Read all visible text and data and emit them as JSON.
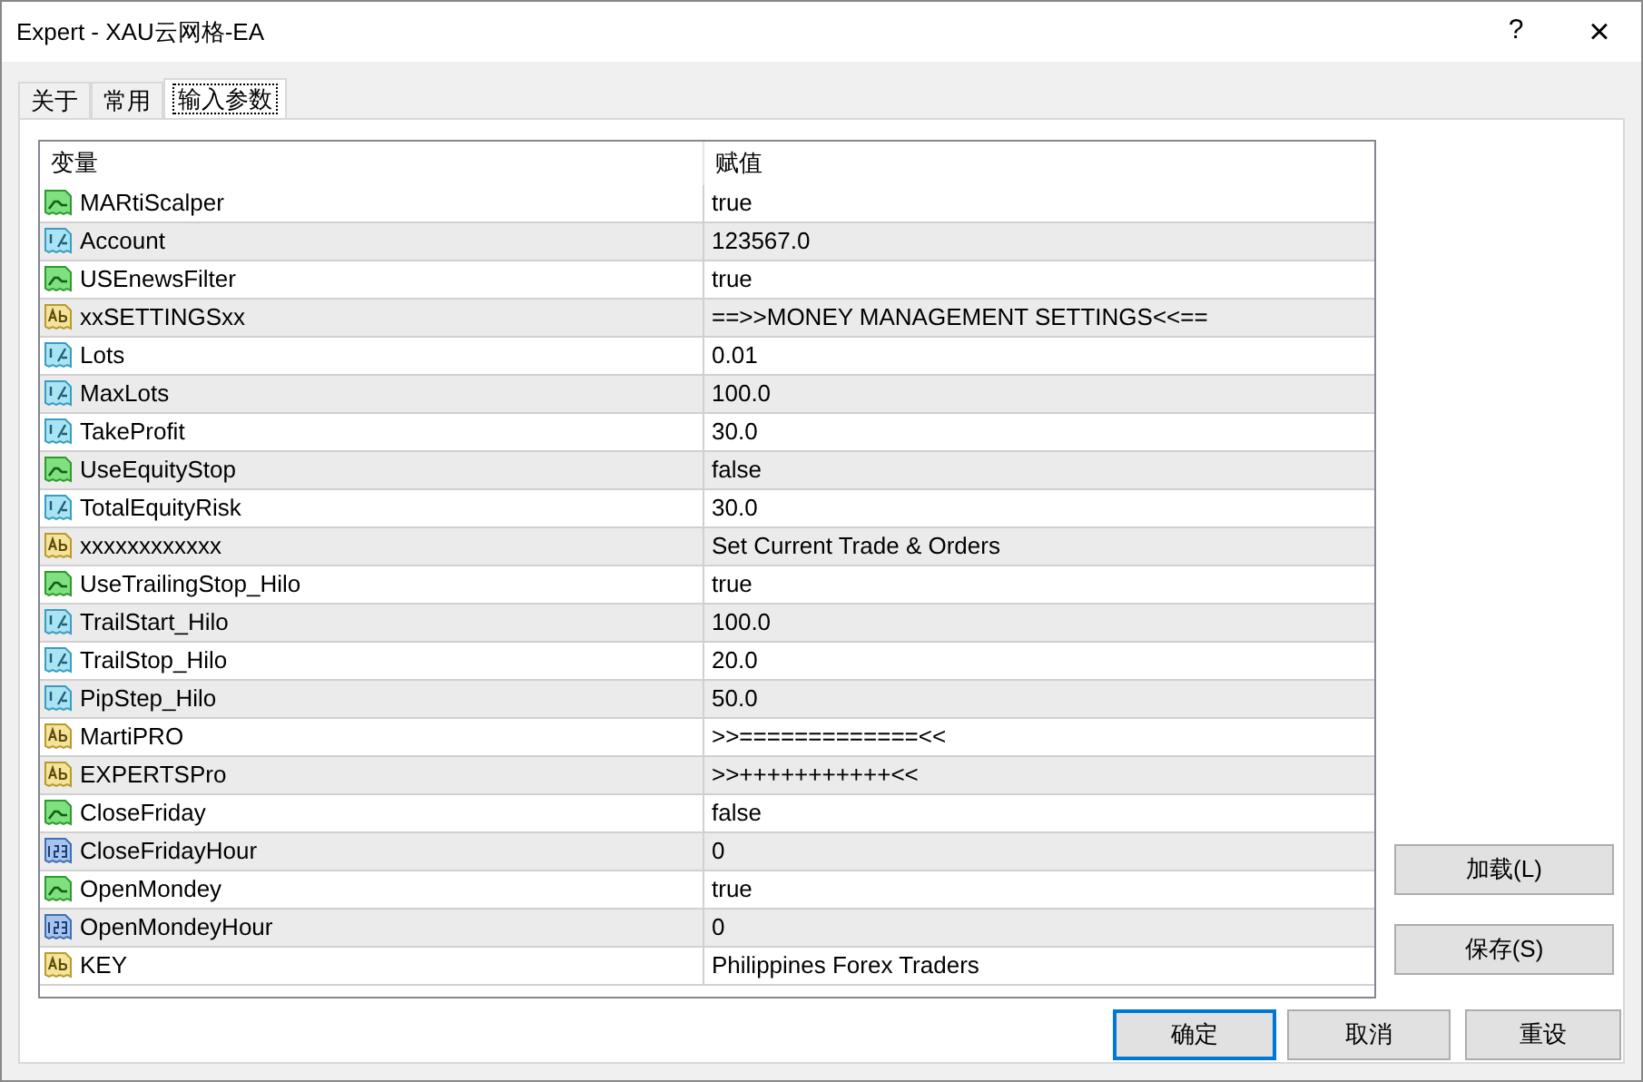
{
  "window": {
    "title": "Expert - XAU云网格-EA",
    "help": "?",
    "close": "×"
  },
  "tabs": [
    {
      "label": "关于",
      "selected": false
    },
    {
      "label": "常用",
      "selected": false
    },
    {
      "label": "输入参数",
      "selected": true
    }
  ],
  "table": {
    "columns": [
      "变量",
      "赋值"
    ],
    "rows": [
      {
        "kind": "bool",
        "name": "MARtiScalper",
        "value": "true"
      },
      {
        "kind": "double",
        "name": "Account",
        "value": "123567.0"
      },
      {
        "kind": "bool",
        "name": "USEnewsFilter",
        "value": "true"
      },
      {
        "kind": "string",
        "name": "xxSETTINGSxx",
        "value": "==>>MONEY MANAGEMENT SETTINGS<<=="
      },
      {
        "kind": "double",
        "name": "Lots",
        "value": "0.01"
      },
      {
        "kind": "double",
        "name": "MaxLots",
        "value": "100.0"
      },
      {
        "kind": "double",
        "name": "TakeProfit",
        "value": "30.0"
      },
      {
        "kind": "bool",
        "name": "UseEquityStop",
        "value": "false"
      },
      {
        "kind": "double",
        "name": "TotalEquityRisk",
        "value": "30.0"
      },
      {
        "kind": "string",
        "name": "xxxxxxxxxxxx",
        "value": "Set Current Trade & Orders"
      },
      {
        "kind": "bool",
        "name": "UseTrailingStop_Hilo",
        "value": "true"
      },
      {
        "kind": "double",
        "name": "TrailStart_Hilo",
        "value": "100.0"
      },
      {
        "kind": "double",
        "name": "TrailStop_Hilo",
        "value": "20.0"
      },
      {
        "kind": "double",
        "name": "PipStep_Hilo",
        "value": "50.0"
      },
      {
        "kind": "string",
        "name": "MartiPRO",
        "value": ">>=============<<"
      },
      {
        "kind": "string",
        "name": "EXPERTSPro",
        "value": ">>+++++++++++<<"
      },
      {
        "kind": "bool",
        "name": "CloseFriday",
        "value": "false"
      },
      {
        "kind": "int",
        "name": "CloseFridayHour",
        "value": "0"
      },
      {
        "kind": "bool",
        "name": "OpenMondey",
        "value": "true"
      },
      {
        "kind": "int",
        "name": "OpenMondeyHour",
        "value": "0"
      },
      {
        "kind": "string",
        "name": "KEY",
        "value": "Philippines Forex Traders"
      }
    ]
  },
  "side_buttons": [
    "加载(L)",
    "保存(S)"
  ],
  "footer_buttons": [
    {
      "label": "确定",
      "default": true
    },
    {
      "label": "取消",
      "default": false
    },
    {
      "label": "重设",
      "default": false
    }
  ]
}
